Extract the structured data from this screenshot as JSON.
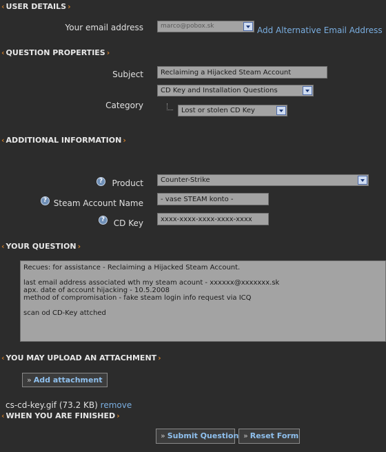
{
  "sections": {
    "user_details": "USER DETAILS",
    "question_properties": "QUESTION PROPERTIES",
    "additional_information": "ADDITIONAL INFORMATION",
    "your_question": "YOUR QUESTION",
    "upload_attachment": "YOU MAY UPLOAD AN ATTACHMENT",
    "when_finished": "WHEN YOU ARE FINISHED"
  },
  "chevron_left": "‹",
  "chevron_right": "›",
  "user_details": {
    "email_label": "Your email address",
    "email_value": "marco@pobox.sk",
    "add_alt_email_link": "Add Alternative Email Address"
  },
  "question_properties": {
    "subject_label": "Subject",
    "subject_value": "Reclaiming a Hijacked Steam Account",
    "category_label": "Category",
    "category_value": "CD Key and Installation Questions",
    "subcategory_value": "Lost or stolen CD Key"
  },
  "additional_information": {
    "product_label": "Product",
    "product_value": "Counter-Strike",
    "steam_account_label": "Steam Account Name",
    "steam_account_value": "- vase STEAM konto -",
    "cd_key_label": "CD Key",
    "cd_key_value": "xxxx-xxxx-xxxx-xxxx-xxxx",
    "help_icon_glyph": "?"
  },
  "question": {
    "lines": [
      "Recues: for assistance - Reclaiming a Hijacked Steam Account.",
      "",
      "last email address associated wth my steam acount - xxxxxx@xxxxxxx.sk",
      "apx. date of account hijacking - 10.5.2008",
      "method of compromisation - fake steam login info request via ICQ",
      "",
      "scan od CD-Key attched"
    ]
  },
  "attachment": {
    "add_button": "Add attachment",
    "file_text": "cs-cd-key.gif (73.2 KB)",
    "remove_link": "remove"
  },
  "buttons": {
    "prefix": "»",
    "submit": "Submit Question",
    "reset": "Reset Form"
  },
  "colors": {
    "background": "#2c2c2c",
    "accent_orange": "#c77a2a",
    "link_blue": "#7aaee0",
    "field_gray": "#a3a3a3"
  }
}
